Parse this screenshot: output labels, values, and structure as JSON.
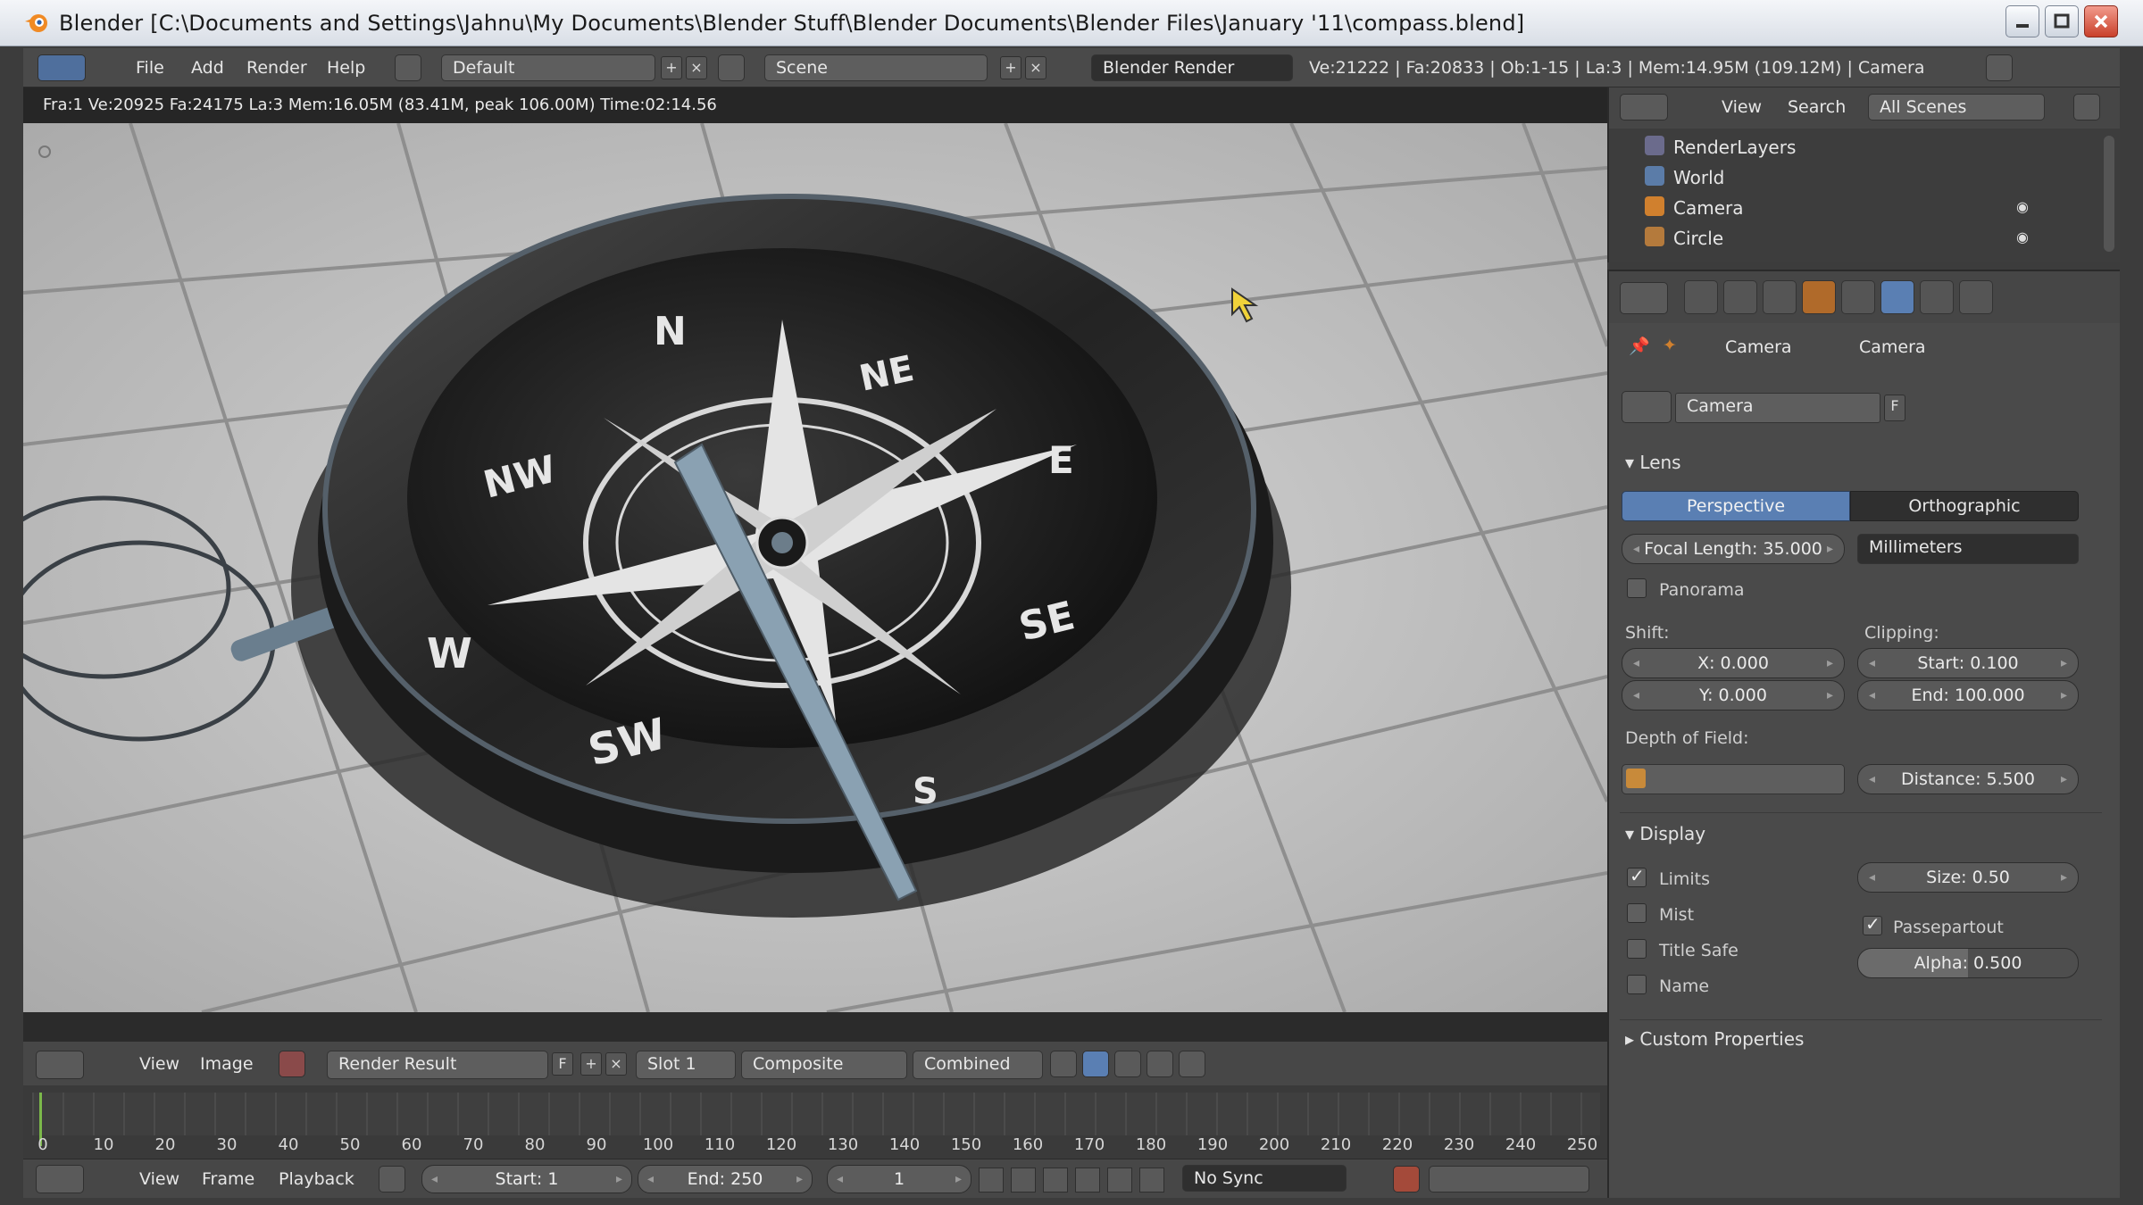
{
  "window": {
    "title": "Blender [C:\\Documents and Settings\\Jahnu\\My Documents\\Blender Stuff\\Blender Documents\\Blender Files\\January '11\\compass.blend]"
  },
  "info_header": {
    "menus": [
      "File",
      "Add",
      "Render",
      "Help"
    ],
    "screen_layout": "Default",
    "scene": "Scene",
    "render_engine": "Blender Render",
    "stats": "Ve:21222 | Fa:20833 | Ob:1-15 | La:3 | Mem:14.95M (109.12M) | Camera"
  },
  "render": {
    "status": "Fra:1  Ve:20925 Fa:24175 La:3 Mem:16.05M (83.41M, peak 106.00M) Time:02:14.56",
    "compass_labels": [
      "N",
      "NE",
      "E",
      "SE",
      "S",
      "SW",
      "W",
      "NW"
    ]
  },
  "image_editor": {
    "menus": [
      "View",
      "Image"
    ],
    "image": "Render Result",
    "fake_user": "F",
    "slot": "Slot 1",
    "layer": "Composite",
    "pass": "Combined"
  },
  "timeline": {
    "ticks": [
      "0",
      "10",
      "20",
      "30",
      "40",
      "50",
      "60",
      "70",
      "80",
      "90",
      "100",
      "110",
      "120",
      "130",
      "140",
      "150",
      "160",
      "170",
      "180",
      "190",
      "200",
      "210",
      "220",
      "230",
      "240",
      "250"
    ],
    "menus": [
      "View",
      "Frame",
      "Playback"
    ],
    "start": "Start: 1",
    "end": "End: 250",
    "current": "1",
    "sync": "No Sync"
  },
  "outliner": {
    "menus": [
      "View",
      "Search"
    ],
    "filter": "All Scenes",
    "items": [
      {
        "label": "RenderLayers"
      },
      {
        "label": "World"
      },
      {
        "label": "Camera"
      },
      {
        "label": "Circle"
      }
    ]
  },
  "properties": {
    "breadcrumb": [
      "Camera",
      "Camera"
    ],
    "datablock": "Camera",
    "fake_user": "F",
    "lens": {
      "title": "Lens",
      "tab_perspective": "Perspective",
      "tab_orthographic": "Orthographic",
      "focal_length": "Focal Length: 35.000",
      "units": "Millimeters",
      "panorama": "Panorama"
    },
    "shift": {
      "title": "Shift:",
      "x": "X: 0.000",
      "y": "Y: 0.000"
    },
    "clipping": {
      "title": "Clipping:",
      "start": "Start: 0.100",
      "end": "End: 100.000"
    },
    "dof": {
      "title": "Depth of Field:",
      "distance": "Distance: 5.500"
    },
    "display": {
      "title": "Display",
      "limits": "Limits",
      "mist": "Mist",
      "title_safe": "Title Safe",
      "name": "Name",
      "size": "Size: 0.50",
      "passepartout": "Passepartout",
      "alpha": "Alpha: 0.500"
    },
    "custom": "Custom Properties"
  },
  "colors": {
    "accent": "#5a7fb3",
    "panel": "#4a4a4a",
    "header": "#474747"
  }
}
